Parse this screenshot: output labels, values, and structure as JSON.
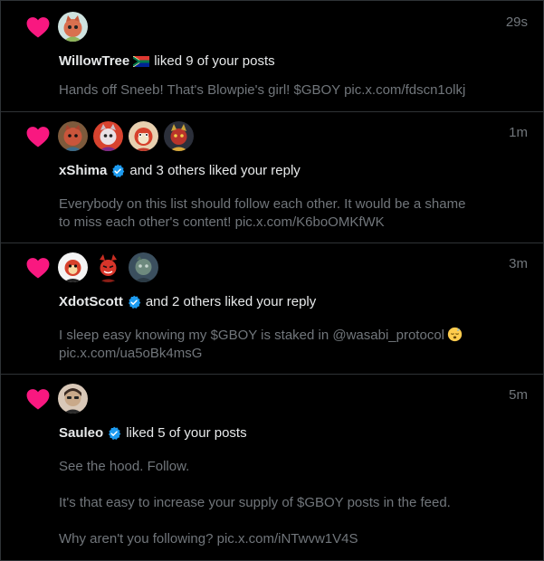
{
  "colors": {
    "background": "#000000",
    "heart": "#f91880",
    "verified": "#1d9bf0",
    "primary_text": "#e7e9ea",
    "secondary_text": "#71767b",
    "divider": "#2f3336"
  },
  "notifications": [
    {
      "icon": "heart-icon",
      "time": "29s",
      "user": "WillowTree",
      "user_badge": "south-africa-flag-icon",
      "action": "liked 9 of your posts",
      "body_lines": [
        "Hands off Sneeb!  That's Blowpie's girl! $GBOY pic.x.com/fdscn1olkj"
      ]
    },
    {
      "icon": "heart-icon",
      "time": "1m",
      "user": "xShima",
      "user_badge": "verified-badge-icon",
      "action": "and 3 others liked your reply",
      "body_lines": [
        "Everybody on this list should follow each other.  It would be a shame",
        "to miss each other's content! pic.x.com/K6boOMKfWK"
      ]
    },
    {
      "icon": "heart-icon",
      "time": "3m",
      "user": "XdotScott",
      "user_badge": "verified-badge-icon",
      "action": "and 2 others liked your reply",
      "body_lines": [
        "I sleep easy knowing my $GBOY is staked in @wasabi_protocol",
        "pic.x.com/ua5oBk4msG"
      ],
      "emoji": "sleeping-face-emoji"
    },
    {
      "icon": "heart-icon",
      "time": "5m",
      "user": "Sauleo",
      "user_badge": "verified-badge-icon",
      "action": "liked 5 of your posts",
      "paragraphs": [
        "See the hood.  Follow.",
        "It's that easy to increase your supply of $GBOY  posts in the feed.",
        "Why aren't you following? pic.x.com/iNTwvw1V4S"
      ]
    }
  ]
}
